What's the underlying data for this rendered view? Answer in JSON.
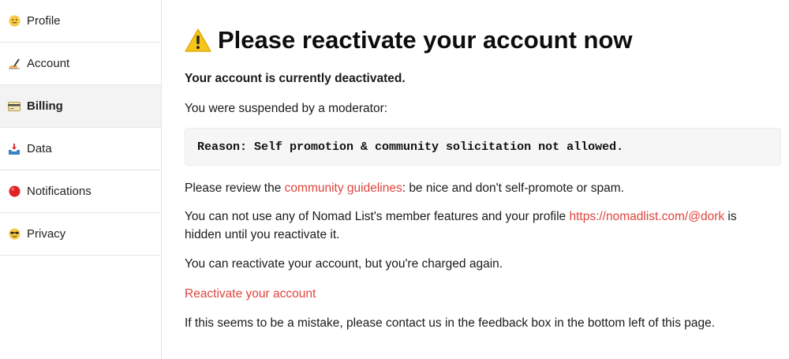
{
  "sidebar": {
    "items": [
      {
        "label": "Profile",
        "icon": "smiley-face-icon"
      },
      {
        "label": "Account",
        "icon": "writing-hand-icon"
      },
      {
        "label": "Billing",
        "icon": "credit-card-icon",
        "active": true
      },
      {
        "label": "Data",
        "icon": "inbox-tray-icon"
      },
      {
        "label": "Notifications",
        "icon": "red-circle-icon"
      },
      {
        "label": "Privacy",
        "icon": "sunglasses-face-icon"
      }
    ]
  },
  "main": {
    "title": "Please reactivate your account now",
    "deactivated": "Your account is currently deactivated.",
    "suspended": "You were suspended by a moderator:",
    "reason": "Reason: Self promotion & community solicitation not allowed.",
    "review_prefix": "Please review the ",
    "review_link": "community guidelines",
    "review_suffix": ": be nice and don't self-promote or spam.",
    "features_prefix": "You can not use any of Nomad List's member features and your profile ",
    "profile_link": "https://nomadlist.com/@dork",
    "features_suffix": " is hidden until you reactivate it.",
    "charge_note": "You can reactivate your account, but you're charged again.",
    "reactivate_link": "Reactivate your account",
    "mistake_note": "If this seems to be a mistake, please contact us in the feedback box in the bottom left of this page."
  },
  "colors": {
    "link": "#e0443c",
    "warning": "#f5c518",
    "active_bg": "#f3f3f3"
  }
}
